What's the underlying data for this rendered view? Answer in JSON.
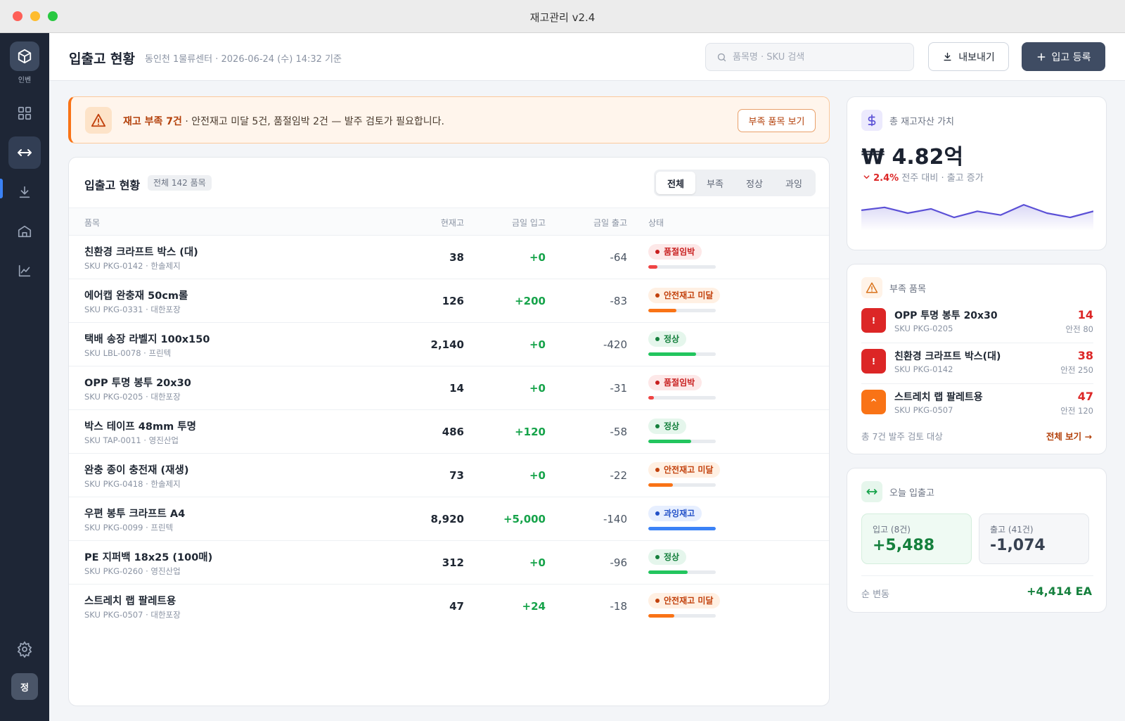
{
  "window": {
    "title": "재고관리 v2.4"
  },
  "sidebar": {
    "logo_label": "인벤",
    "avatar": "정"
  },
  "header": {
    "title": "입출고 현황",
    "subtitle": "동인천 1물류센터 · 2026-06-24 (수) 14:32 기준",
    "search_placeholder": "품목명 · SKU 검색",
    "export_label": "내보내기",
    "add_label": "입고 등록"
  },
  "alert": {
    "title": "재고 부족 7건",
    "message": " · 안전재고 미달 5건, 품절임박 2건 — 발주 검토가 필요합니다.",
    "button": "부족 품목 보기"
  },
  "table": {
    "title": "입출고 현황",
    "badge": "전체 142 품목",
    "tabs": [
      "전체",
      "부족",
      "정상",
      "과잉"
    ],
    "active_tab": 0,
    "columns": [
      "품목",
      "현재고",
      "금일 입고",
      "금일 출고",
      "상태"
    ],
    "rows": [
      {
        "name": "친환경 크라프트 박스 (대)",
        "sku": "SKU PKG-0142 · 한솔제지",
        "stock": "38",
        "in": "+0",
        "out": "-64",
        "status": "품절임박",
        "level": "danger",
        "fill": 0.14
      },
      {
        "name": "에어캡 완충재 50cm롤",
        "sku": "SKU PKG-0331 · 대한포장",
        "stock": "126",
        "in": "+200",
        "out": "-83",
        "status": "안전재고 미달",
        "level": "warn",
        "fill": 0.42
      },
      {
        "name": "택배 송장 라벨지 100x150",
        "sku": "SKU LBL-0078 · 프린텍",
        "stock": "2,140",
        "in": "+0",
        "out": "-420",
        "status": "정상",
        "level": "ok",
        "fill": 0.71
      },
      {
        "name": "OPP 투명 봉투 20x30",
        "sku": "SKU PKG-0205 · 대한포장",
        "stock": "14",
        "in": "+0",
        "out": "-31",
        "status": "품절임박",
        "level": "danger",
        "fill": 0.08
      },
      {
        "name": "박스 테이프 48mm 투명",
        "sku": "SKU TAP-0011 · 영진산업",
        "stock": "486",
        "in": "+120",
        "out": "-58",
        "status": "정상",
        "level": "ok",
        "fill": 0.64
      },
      {
        "name": "완충 종이 충전재 (재생)",
        "sku": "SKU PKG-0418 · 한솔제지",
        "stock": "73",
        "in": "+0",
        "out": "-22",
        "status": "안전재고 미달",
        "level": "warn",
        "fill": 0.36
      },
      {
        "name": "우편 봉투 크라프트 A4",
        "sku": "SKU PKG-0099 · 프린텍",
        "stock": "8,920",
        "in": "+5,000",
        "out": "-140",
        "status": "과잉재고",
        "level": "over",
        "fill": 1.0
      },
      {
        "name": "PE 지퍼백 18x25 (100매)",
        "sku": "SKU PKG-0260 · 영진산업",
        "stock": "312",
        "in": "+0",
        "out": "-96",
        "status": "정상",
        "level": "ok",
        "fill": 0.58
      },
      {
        "name": "스트레치 랩 팔레트용",
        "sku": "SKU PKG-0507 · 대한포장",
        "stock": "47",
        "in": "+24",
        "out": "-18",
        "status": "안전재고 미달",
        "level": "warn",
        "fill": 0.39
      }
    ]
  },
  "value_card": {
    "label": "총 재고자산 가치",
    "value": "₩ 4.82억",
    "change": "2.4%",
    "change_note": " 전주 대비 · 출고 증가",
    "trend": [
      0.62,
      0.74,
      0.5,
      0.68,
      0.32,
      0.58,
      0.42,
      0.85,
      0.5,
      0.32,
      0.58
    ]
  },
  "low_stock": {
    "label": "부족 품목",
    "items": [
      {
        "name": "OPP 투명 봉투 20x30",
        "sku": "SKU PKG-0205",
        "qty": "14",
        "safe": "안전 80",
        "icon": "!",
        "color": "#dc2626"
      },
      {
        "name": "친환경 크라프트 박스(대)",
        "sku": "SKU PKG-0142",
        "qty": "38",
        "safe": "안전 250",
        "icon": "!",
        "color": "#dc2626"
      },
      {
        "name": "스트레치 랩 팔레트용",
        "sku": "SKU PKG-0507",
        "qty": "47",
        "safe": "안전 120",
        "icon": "^",
        "color": "#f97316"
      }
    ],
    "footer": "총 7건 발주 검토 대상",
    "link": "전체 보기 →"
  },
  "today": {
    "label": "오늘 입출고",
    "in_label": "입고 (8건)",
    "in_value": "+5,488",
    "out_label": "출고 (41건)",
    "out_value": "-1,074",
    "net_label": "순 변동",
    "net_value": "+4,414 EA"
  },
  "colors": {
    "danger": "#ef4444",
    "warn": "#f97316",
    "ok": "#22c55e",
    "over": "#3b82f6",
    "sidebar": "#1e2636",
    "accent_purple": "#5b50d6"
  }
}
